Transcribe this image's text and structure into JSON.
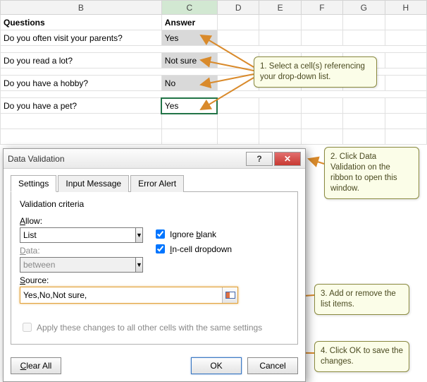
{
  "columns": [
    "B",
    "C",
    "D",
    "E",
    "F",
    "G",
    "H"
  ],
  "header": {
    "questions": "Questions",
    "answer": "Answer"
  },
  "rows": {
    "q1": {
      "text": "Do you often visit your parents?",
      "answer": "Yes"
    },
    "q2": {
      "text": "Do you read a lot?",
      "answer": "Not sure"
    },
    "q3": {
      "text": "Do you have a hobby?",
      "answer": "No"
    },
    "q4": {
      "text": "Do you have a pet?",
      "answer": "Yes"
    }
  },
  "dialog": {
    "title": "Data Validation",
    "tabs": {
      "settings": "Settings",
      "input": "Input Message",
      "error": "Error Alert"
    },
    "criteria_label": "Validation criteria",
    "allow_label": "Allow:",
    "allow_value": "List",
    "ignore_blank": "Ignore blank",
    "incell": "In-cell dropdown",
    "data_label": "Data:",
    "data_value": "between",
    "source_label": "Source:",
    "source_value": "Yes,No,Not sure,",
    "apply_label": "Apply these changes to all other cells with the same settings",
    "clear": "Clear All",
    "ok": "OK",
    "cancel": "Cancel",
    "help_glyph": "?",
    "close_glyph": "✕",
    "chev": "▼"
  },
  "callouts": {
    "c1": "1. Select a cell(s) referencing your drop-down list.",
    "c2": "2. Click Data Validation on the ribbon to open this window.",
    "c3": "3. Add or remove the list items.",
    "c4": "4. Click OK to save the changes."
  }
}
